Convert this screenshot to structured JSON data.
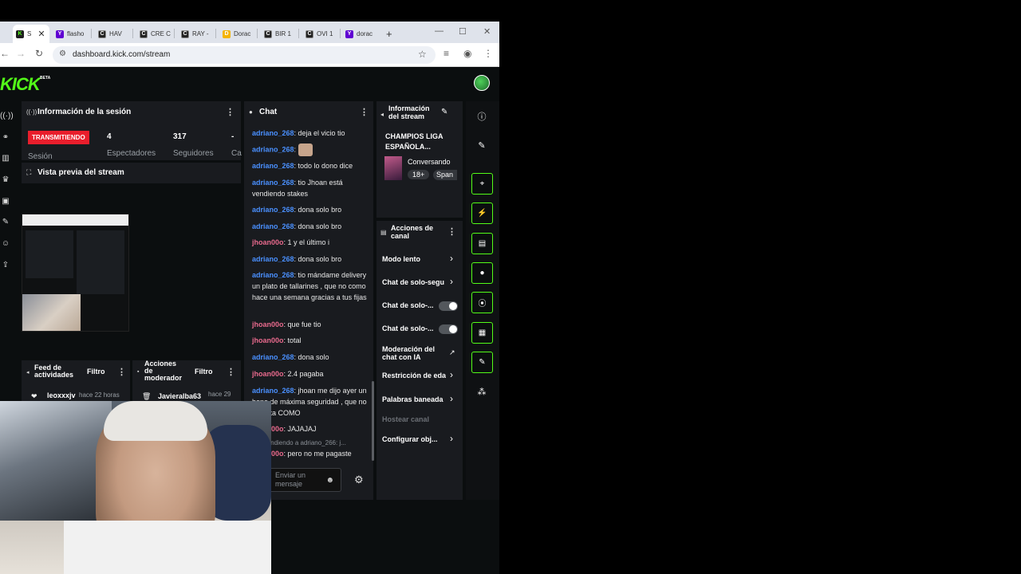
{
  "browser": {
    "tabs": [
      {
        "label": "S",
        "icon": "kick-favicon",
        "active": true
      },
      {
        "label": "flasho",
        "icon": "yahoo-favicon"
      },
      {
        "label": "HAV",
        "icon": "c-favicon"
      },
      {
        "label": "CRE C",
        "icon": "c-favicon"
      },
      {
        "label": "RAY -",
        "icon": "c-favicon"
      },
      {
        "label": "Dorac",
        "icon": "d-favicon"
      },
      {
        "label": "BIR 1",
        "icon": "c-favicon"
      },
      {
        "label": "OVI 1",
        "icon": "c-favicon"
      },
      {
        "label": "dorac",
        "icon": "yahoo-favicon"
      }
    ],
    "new_tab": "+",
    "url": "dashboard.kick.com/stream"
  },
  "kick": {
    "logo": "KICK",
    "logo_sup": "BETA"
  },
  "session": {
    "title": "Información de la sesión",
    "live_badge": "TRANSMITIENDO",
    "session_label": "Sesión",
    "viewers_value": "4",
    "viewers_label": "Espectadores",
    "followers_value": "317",
    "followers_label": "Seguidores",
    "extra_value": "-",
    "extra_label": "Ca"
  },
  "preview": {
    "title": "Vista previa del stream"
  },
  "feed": {
    "title_line1": "Feed de",
    "title_line2": "actividades",
    "filter": "Filtro",
    "entry_user": "leoxxxjv",
    "entry_time": "hace 22 horas"
  },
  "modactions": {
    "title_line1": "Acciones",
    "title_line2": "de",
    "title_line3": "moderador",
    "filter": "Filtro",
    "entry_user": "Javieralba63",
    "entry_time": "hace 29"
  },
  "chat": {
    "title": "Chat",
    "messages": [
      {
        "user": "adriano_268",
        "text": ": deja el vicio tio",
        "color": "blue"
      },
      {
        "user": "adriano_268",
        "text": ":",
        "color": "blue"
      },
      {
        "user": "adriano_268",
        "text": ": todo lo dono dice",
        "color": "blue"
      },
      {
        "user": "adriano_268",
        "text": ": tio Jhoan está vendiendo stakes",
        "color": "blue"
      },
      {
        "user": "adriano_268",
        "text": ": dona solo bro",
        "color": "blue"
      },
      {
        "user": "adriano_268",
        "text": ": dona solo bro",
        "color": "blue"
      },
      {
        "user": "jhoan00o",
        "text": ": 1 y el último i",
        "color": "pink"
      },
      {
        "user": "adriano_268",
        "text": ": dona solo bro",
        "color": "blue"
      },
      {
        "user": "adriano_268",
        "text": ": tio mándame delivery un plato de tallarines , que no como hace una semana gracias a tus fijas",
        "color": "blue"
      },
      {
        "user": "jhoan00o",
        "text": ": que fue tio",
        "color": "pink"
      },
      {
        "user": "jhoan00o",
        "text": ": total",
        "color": "pink"
      },
      {
        "user": "adriano_268",
        "text": ": dona solo",
        "color": "blue"
      },
      {
        "user": "jhoan00o",
        "text": ": 2.4 pagaba",
        "color": "pink"
      },
      {
        "user": "adriano_268",
        "text": ": jhoan me dijo ayer un bono de máxima seguridad , que no empata COMO",
        "color": "blue"
      },
      {
        "user": "jhoan00o",
        "text": ": JAJAJAJ",
        "color": "pink"
      },
      {
        "user": "",
        "text": "Respondiendo a adriano_266: j...",
        "color": "grey"
      },
      {
        "user": "jhoan00o",
        "text": ": pero no me pagaste",
        "color": "pink"
      }
    ],
    "input_placeholder": "Enviar un mensaje"
  },
  "streaminfo": {
    "title_line1": "Información",
    "title_line2": "del stream",
    "stream_title": "CHAMPIOS LIGA ESPAÑOLA...",
    "category": "Conversando",
    "tags": [
      "18+",
      "Span"
    ]
  },
  "channel_actions": {
    "title_line1": "Acciones de",
    "title_line2": "canal",
    "items": [
      {
        "label": "Modo lento",
        "control": "chevron"
      },
      {
        "label": "Chat de solo-segu",
        "control": "chevron"
      },
      {
        "label": "Chat de solo-...",
        "control": "toggle"
      },
      {
        "label": "Chat de solo-...",
        "control": "toggle"
      },
      {
        "label": "Moderación del chat con IA",
        "control": "external"
      },
      {
        "label": "Restricción de eda",
        "control": "chevron"
      },
      {
        "label": "Palabras baneada",
        "control": "chevron"
      },
      {
        "label": "Hostear canal",
        "control": "none"
      },
      {
        "label": "Configurar obj...",
        "control": "chevron"
      }
    ]
  },
  "colors": {
    "kick_green": "#53fc18",
    "live_red": "#e91e2c",
    "chat_blue": "#4a90ff",
    "chat_pink": "#e86a8d"
  }
}
